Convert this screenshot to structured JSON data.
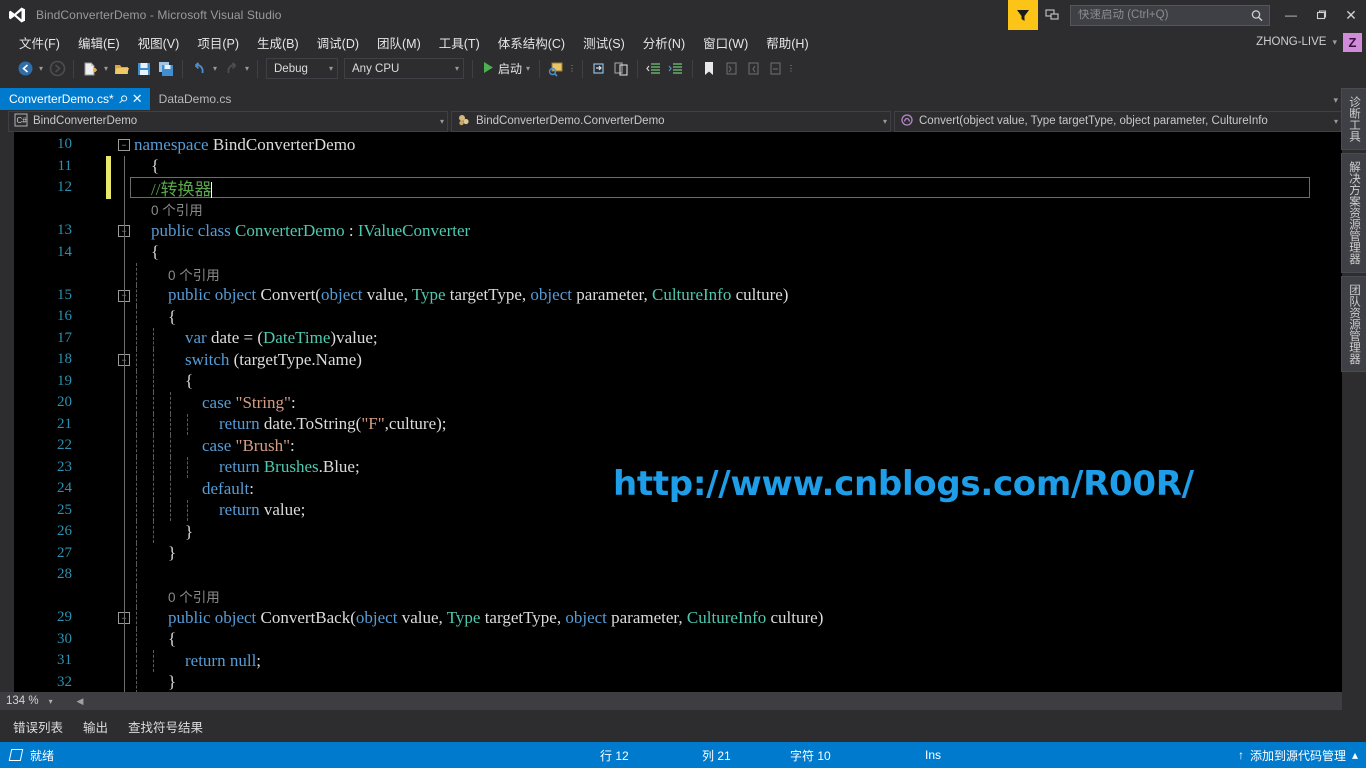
{
  "titlebar": {
    "title": "BindConverterDemo - Microsoft Visual Studio",
    "logo_icon": "visual-studio-logo",
    "feedback_icon": "feedback-icon",
    "notify_icon": "notifications-icon",
    "search_icon": "search-icon",
    "minimize_label": "—",
    "maximize_label": "❐",
    "close_label": "✕"
  },
  "quicklaunch": {
    "placeholder": "快速启动 (Ctrl+Q)",
    "value": ""
  },
  "account": {
    "name": "ZHONG-LIVE",
    "caret": "▾",
    "avatar": "Z"
  },
  "menubar": {
    "items": [
      {
        "label": "文件(F)"
      },
      {
        "label": "编辑(E)"
      },
      {
        "label": "视图(V)"
      },
      {
        "label": "项目(P)"
      },
      {
        "label": "生成(B)"
      },
      {
        "label": "调试(D)"
      },
      {
        "label": "团队(M)"
      },
      {
        "label": "工具(T)"
      },
      {
        "label": "体系结构(C)"
      },
      {
        "label": "测试(S)"
      },
      {
        "label": "分析(N)"
      },
      {
        "label": "窗口(W)"
      },
      {
        "label": "帮助(H)"
      }
    ]
  },
  "toolbar": {
    "back_icon": "navigate-back-icon",
    "forward_icon": "navigate-forward-icon",
    "new_project_icon": "new-project-icon",
    "open_file_icon": "open-file-icon",
    "save_icon": "save-icon",
    "save_all_icon": "save-all-icon",
    "undo_icon": "undo-icon",
    "redo_icon": "redo-icon",
    "config_combo": "Debug",
    "platform_combo": "Any CPU",
    "start_label": "启动",
    "start_icon": "play-icon",
    "attach_icon": "attach-process-icon",
    "step_icons": [
      "step-into-icon",
      "step-over-icon"
    ],
    "indent_icons": [
      "decrease-indent-icon",
      "increase-indent-icon"
    ],
    "bookmark_icon": "bookmark-icon",
    "comment_icons": [
      "comment-icon",
      "uncomment-icon",
      "toggle-icon"
    ],
    "overflow_label": "»"
  },
  "tabs": [
    {
      "label": "ConverterDemo.cs*",
      "active": true,
      "pin_icon": "pin-icon",
      "close_icon": "close-icon"
    },
    {
      "label": "DataDemo.cs",
      "active": false
    }
  ],
  "navbar": {
    "project": {
      "label": "BindConverterDemo",
      "icon": "csharp-file-icon"
    },
    "type": {
      "label": "BindConverterDemo.ConverterDemo",
      "icon": "class-icon"
    },
    "member": {
      "label": "Convert(object value, Type targetType, object parameter, CultureInfo",
      "icon": "method-icon"
    }
  },
  "editor": {
    "zoom": "134 %",
    "watermark": "http://www.cnblogs.com/R00R/",
    "reference_text": "0 个引用",
    "lines": [
      {
        "num": "10",
        "indent": 0,
        "fold": "−",
        "tokens": [
          {
            "t": "namespace ",
            "c": "kw"
          },
          {
            "t": "BindConverterDemo",
            "c": "pln"
          }
        ]
      },
      {
        "num": "11",
        "indent": 1,
        "changed": true,
        "tokens": [
          {
            "t": "{",
            "c": "pln"
          }
        ]
      },
      {
        "num": "12",
        "indent": 1,
        "changed": true,
        "current": true,
        "tokens": [
          {
            "t": "//转换器",
            "c": "cmt"
          }
        ]
      },
      {
        "num": "",
        "indent": 1,
        "ref": true
      },
      {
        "num": "13",
        "indent": 1,
        "fold": "−",
        "tokens": [
          {
            "t": "public class ",
            "c": "kw"
          },
          {
            "t": "ConverterDemo",
            "c": "typ"
          },
          {
            "t": " : ",
            "c": "pln"
          },
          {
            "t": "IValueConverter",
            "c": "typ"
          }
        ]
      },
      {
        "num": "14",
        "indent": 1,
        "tokens": [
          {
            "t": "{",
            "c": "pln"
          }
        ]
      },
      {
        "num": "",
        "indent": 2,
        "ref": true
      },
      {
        "num": "15",
        "indent": 2,
        "fold": "−",
        "tokens": [
          {
            "t": "public object ",
            "c": "kw"
          },
          {
            "t": "Convert(",
            "c": "pln"
          },
          {
            "t": "object",
            "c": "kw"
          },
          {
            "t": " value, ",
            "c": "pln"
          },
          {
            "t": "Type",
            "c": "typ"
          },
          {
            "t": " targetType, ",
            "c": "pln"
          },
          {
            "t": "object",
            "c": "kw"
          },
          {
            "t": " parameter, ",
            "c": "pln"
          },
          {
            "t": "CultureInfo",
            "c": "typ"
          },
          {
            "t": " culture)",
            "c": "pln"
          }
        ]
      },
      {
        "num": "16",
        "indent": 2,
        "tokens": [
          {
            "t": "{",
            "c": "pln"
          }
        ]
      },
      {
        "num": "17",
        "indent": 3,
        "tokens": [
          {
            "t": "var ",
            "c": "kw"
          },
          {
            "t": "date = (",
            "c": "pln"
          },
          {
            "t": "DateTime",
            "c": "typ"
          },
          {
            "t": ")value;",
            "c": "pln"
          }
        ]
      },
      {
        "num": "18",
        "indent": 3,
        "fold": "−",
        "tokens": [
          {
            "t": "switch ",
            "c": "kw"
          },
          {
            "t": "(targetType.Name)",
            "c": "pln"
          }
        ]
      },
      {
        "num": "19",
        "indent": 3,
        "tokens": [
          {
            "t": "{",
            "c": "pln"
          }
        ]
      },
      {
        "num": "20",
        "indent": 4,
        "tokens": [
          {
            "t": "case ",
            "c": "kw"
          },
          {
            "t": "\"String\"",
            "c": "str"
          },
          {
            "t": ":",
            "c": "pln"
          }
        ]
      },
      {
        "num": "21",
        "indent": 5,
        "tokens": [
          {
            "t": "return ",
            "c": "kw"
          },
          {
            "t": "date.ToString(",
            "c": "pln"
          },
          {
            "t": "\"F\"",
            "c": "str"
          },
          {
            "t": ",culture);",
            "c": "pln"
          }
        ]
      },
      {
        "num": "22",
        "indent": 4,
        "tokens": [
          {
            "t": "case ",
            "c": "kw"
          },
          {
            "t": "\"Brush\"",
            "c": "str"
          },
          {
            "t": ":",
            "c": "pln"
          }
        ]
      },
      {
        "num": "23",
        "indent": 5,
        "tokens": [
          {
            "t": "return ",
            "c": "kw"
          },
          {
            "t": "Brushes",
            "c": "typ"
          },
          {
            "t": ".Blue;",
            "c": "pln"
          }
        ]
      },
      {
        "num": "24",
        "indent": 4,
        "tokens": [
          {
            "t": "default",
            "c": "kw"
          },
          {
            "t": ":",
            "c": "pln"
          }
        ]
      },
      {
        "num": "25",
        "indent": 5,
        "tokens": [
          {
            "t": "return ",
            "c": "kw"
          },
          {
            "t": "value;",
            "c": "pln"
          }
        ]
      },
      {
        "num": "26",
        "indent": 3,
        "tokens": [
          {
            "t": "}",
            "c": "pln"
          }
        ]
      },
      {
        "num": "27",
        "indent": 2,
        "tokens": [
          {
            "t": "}",
            "c": "pln"
          }
        ]
      },
      {
        "num": "28",
        "indent": 2,
        "tokens": []
      },
      {
        "num": "",
        "indent": 2,
        "ref": true
      },
      {
        "num": "29",
        "indent": 2,
        "fold": "−",
        "tokens": [
          {
            "t": "public object ",
            "c": "kw"
          },
          {
            "t": "ConvertBack(",
            "c": "pln"
          },
          {
            "t": "object",
            "c": "kw"
          },
          {
            "t": " value, ",
            "c": "pln"
          },
          {
            "t": "Type",
            "c": "typ"
          },
          {
            "t": " targetType, ",
            "c": "pln"
          },
          {
            "t": "object",
            "c": "kw"
          },
          {
            "t": " parameter, ",
            "c": "pln"
          },
          {
            "t": "CultureInfo",
            "c": "typ"
          },
          {
            "t": " culture)",
            "c": "pln"
          }
        ]
      },
      {
        "num": "30",
        "indent": 2,
        "tokens": [
          {
            "t": "{",
            "c": "pln"
          }
        ]
      },
      {
        "num": "31",
        "indent": 3,
        "tokens": [
          {
            "t": "return ",
            "c": "kw"
          },
          {
            "t": "null",
            "c": "kw"
          },
          {
            "t": ";",
            "c": "pln"
          }
        ]
      },
      {
        "num": "32",
        "indent": 2,
        "tokens": [
          {
            "t": "}",
            "c": "pln"
          }
        ]
      }
    ]
  },
  "right_tabs": [
    {
      "label": "诊断工具"
    },
    {
      "label": "解决方案资源管理器"
    },
    {
      "label": "团队资源管理器"
    }
  ],
  "panel_tabs": [
    {
      "label": "错误列表"
    },
    {
      "label": "输出"
    },
    {
      "label": "查找符号结果"
    }
  ],
  "statusbar": {
    "ready": "就绪",
    "ready_icon": "ready-icon",
    "line": "行 12",
    "column": "列 21",
    "character": "字符 10",
    "insert_mode": "Ins",
    "source_control": "添加到源代码管理",
    "source_control_icon": "upload-arrow-icon",
    "source_control_caret": "▴"
  },
  "colors": {
    "accent": "#007acc",
    "chrome": "#2d2d30",
    "editor_bg": "#000000",
    "line_number": "#2b91af",
    "keyword": "#569cd6",
    "type": "#4ec9b0",
    "string": "#d69d85",
    "comment": "#57a64a",
    "plain": "#dcdcdc",
    "watermark": "#1e9ee8",
    "change_bar": "#e8e86a",
    "feedback": "#fcc417",
    "avatar": "#d08cd8"
  }
}
